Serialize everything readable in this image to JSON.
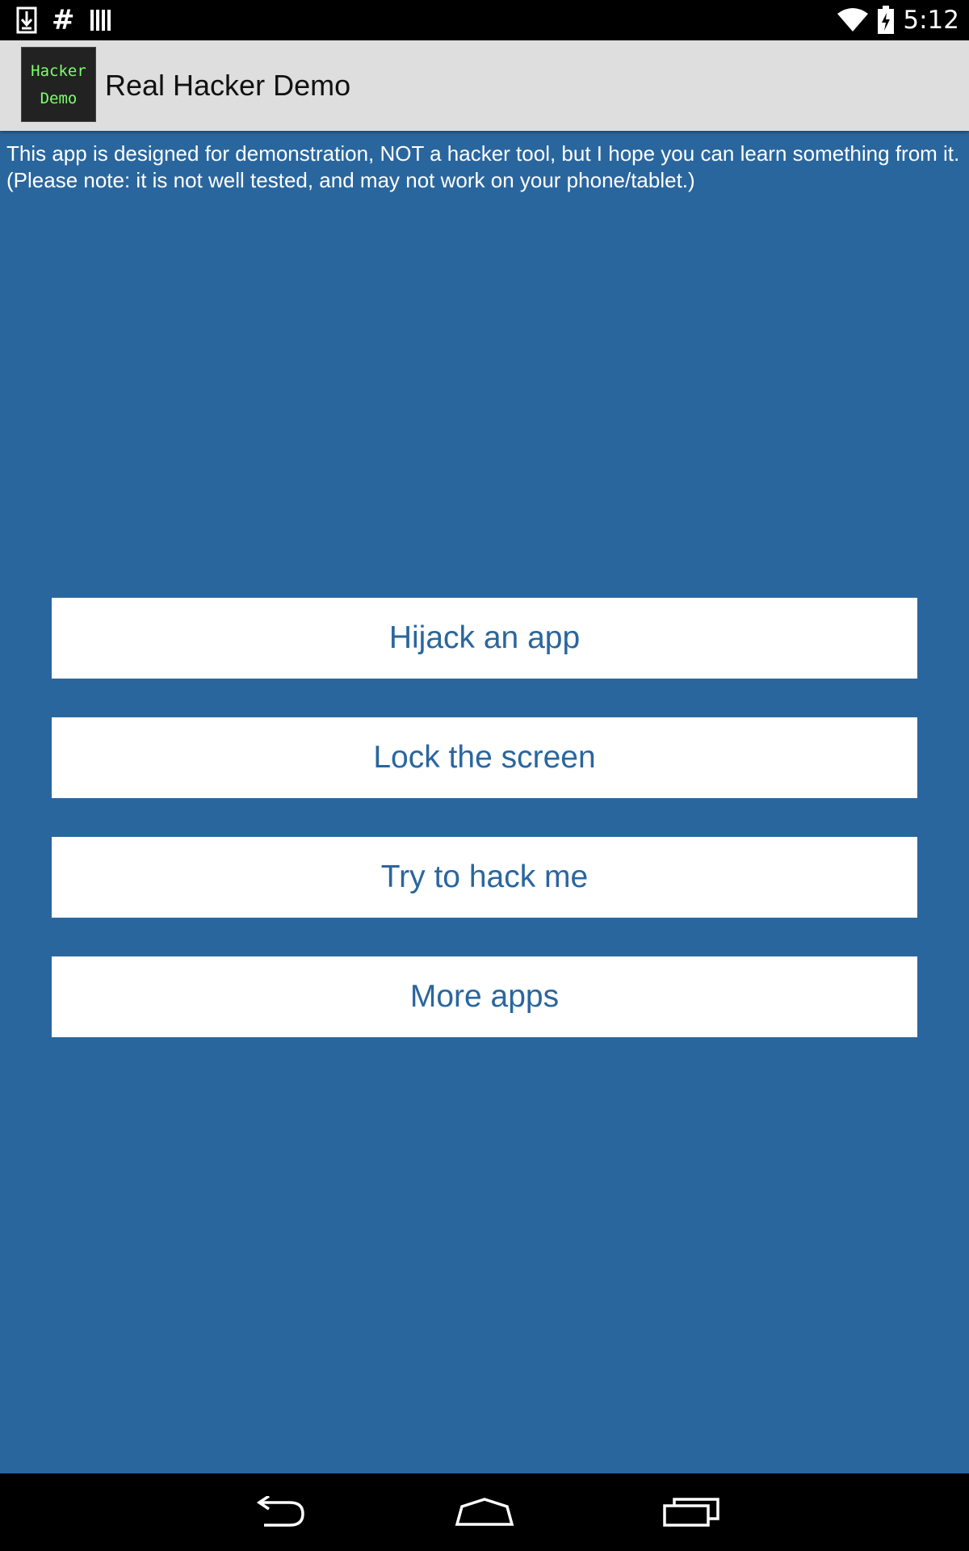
{
  "status_bar": {
    "time": "5:12",
    "icons": [
      "download-icon",
      "hash-icon",
      "barcode-icon",
      "wifi-icon",
      "battery-charging-icon"
    ]
  },
  "action_bar": {
    "logo_line1": "Hacker",
    "logo_line2": "Demo",
    "title": "Real Hacker Demo"
  },
  "description": "This app is designed for demonstration, NOT a hacker tool, but I hope you can learn something from it. (Please note: it is not well tested, and may not work on your phone/tablet.)",
  "buttons": [
    {
      "label": "Hijack an app"
    },
    {
      "label": "Lock the screen"
    },
    {
      "label": "Try to hack me"
    },
    {
      "label": "More apps"
    }
  ],
  "nav_bar": {
    "icons": [
      "back-icon",
      "home-icon",
      "recent-apps-icon"
    ]
  },
  "colors": {
    "background": "#2a669e",
    "button_text": "#2a669e",
    "logo_text": "#7cff6b",
    "action_bar": "#dedede"
  }
}
